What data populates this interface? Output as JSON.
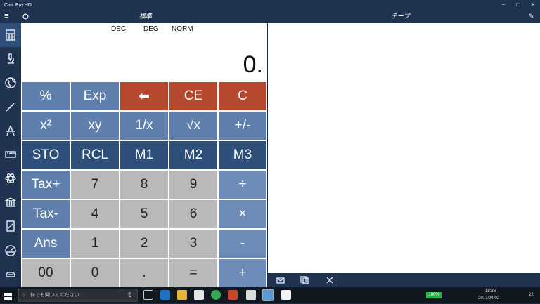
{
  "window": {
    "title": "Calc Pro HD",
    "min_glyph": "−",
    "max_glyph": "□",
    "close_glyph": "✕"
  },
  "header": {
    "calc_title": "標準",
    "tape_title": "テープ"
  },
  "sidebar": {
    "items": [
      {
        "icon": "calculator-icon"
      },
      {
        "icon": "microscope-icon"
      },
      {
        "icon": "globe-icon"
      },
      {
        "icon": "ruler-icon"
      },
      {
        "icon": "compass-icon"
      },
      {
        "icon": "tape-measure-icon"
      },
      {
        "icon": "atom-icon"
      },
      {
        "icon": "bank-icon"
      },
      {
        "icon": "notepad-icon"
      },
      {
        "icon": "gauge-icon"
      },
      {
        "icon": "car-icon"
      }
    ]
  },
  "calc": {
    "mode_dec": "DEC",
    "mode_deg": "DEG",
    "mode_norm": "NORM",
    "display_value": "0."
  },
  "keys": [
    {
      "label": "%",
      "style": "fn"
    },
    {
      "label": "Exp",
      "style": "fn"
    },
    {
      "label": "⬅",
      "style": "red"
    },
    {
      "label": "CE",
      "style": "red"
    },
    {
      "label": "C",
      "style": "red"
    },
    {
      "label": "x²",
      "style": "fn"
    },
    {
      "label": "xy",
      "style": "fn"
    },
    {
      "label": "1/x",
      "style": "fn"
    },
    {
      "label": "√x",
      "style": "fn"
    },
    {
      "label": "+/-",
      "style": "fn"
    },
    {
      "label": "STO",
      "style": "mem"
    },
    {
      "label": "RCL",
      "style": "mem"
    },
    {
      "label": "M1",
      "style": "mem"
    },
    {
      "label": "M2",
      "style": "mem"
    },
    {
      "label": "M3",
      "style": "mem"
    },
    {
      "label": "Tax+",
      "style": "fn"
    },
    {
      "label": "7",
      "style": "num"
    },
    {
      "label": "8",
      "style": "num"
    },
    {
      "label": "9",
      "style": "num"
    },
    {
      "label": "÷",
      "style": "op"
    },
    {
      "label": "Tax-",
      "style": "fn"
    },
    {
      "label": "4",
      "style": "num"
    },
    {
      "label": "5",
      "style": "num"
    },
    {
      "label": "6",
      "style": "num"
    },
    {
      "label": "×",
      "style": "op"
    },
    {
      "label": "Ans",
      "style": "fn"
    },
    {
      "label": "1",
      "style": "num"
    },
    {
      "label": "2",
      "style": "num"
    },
    {
      "label": "3",
      "style": "num"
    },
    {
      "label": "-",
      "style": "op"
    },
    {
      "label": "00",
      "style": "num"
    },
    {
      "label": "0",
      "style": "num"
    },
    {
      "label": ".",
      "style": "num"
    },
    {
      "label": "=",
      "style": "num"
    },
    {
      "label": "+",
      "style": "op"
    }
  ],
  "taskbar": {
    "search_placeholder": "何でも聞いてください",
    "battery": "100%",
    "time": "18:38",
    "date": "2017/04/02",
    "notification_count": "22"
  },
  "colors": {
    "accent_red": "#b6492d",
    "key_blue": "#5f80ad",
    "key_dark_blue": "#2d4f7a",
    "key_gray": "#b9b9b9",
    "chrome": "#1f3350"
  }
}
